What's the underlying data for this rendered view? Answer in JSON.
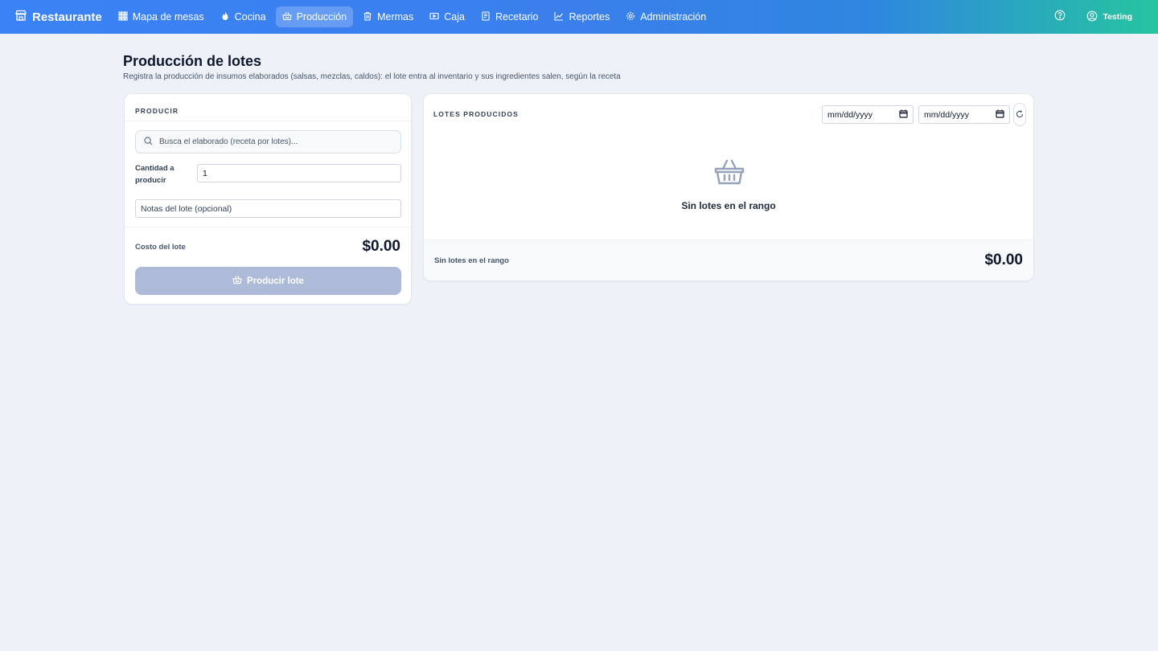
{
  "nav": {
    "brand": "Restaurante",
    "items": [
      {
        "label": "Mapa de mesas",
        "icon": "grid-icon",
        "active": false
      },
      {
        "label": "Cocina",
        "icon": "flame-icon",
        "active": false
      },
      {
        "label": "Producción",
        "icon": "basket-icon",
        "active": true
      },
      {
        "label": "Mermas",
        "icon": "trash-icon",
        "active": false
      },
      {
        "label": "Caja",
        "icon": "cash-icon",
        "active": false
      },
      {
        "label": "Recetario",
        "icon": "book-icon",
        "active": false
      },
      {
        "label": "Reportes",
        "icon": "chart-icon",
        "active": false
      },
      {
        "label": "Administración",
        "icon": "gear-icon",
        "active": false
      }
    ],
    "user": "Testing"
  },
  "page": {
    "title": "Producción de lotes",
    "subtitle": "Registra la producción de insumos elaborados (salsas, mezclas, caldos): el lote entra al inventario y sus ingredientes salen, según la receta"
  },
  "produce": {
    "section_label": "Producir",
    "search_placeholder": "Busca el elaborado (receta por lotes)...",
    "qty_label": "Cantidad a producir",
    "qty_value": "1",
    "notes_placeholder": "Notas del lote (opcional)",
    "cost_label": "Costo del lote",
    "cost_value": "$0.00",
    "button_label": "Producir lote"
  },
  "batches": {
    "section_label": "Lotes producidos",
    "date_from_placeholder": "mm/dd/yyyy",
    "date_to_placeholder": "mm/dd/yyyy",
    "empty_text": "Sin lotes en el rango",
    "footer_text": "Sin lotes en el rango",
    "footer_total": "$0.00"
  },
  "colors": {
    "accent": "#3b82f6",
    "accent_end": "#25c5a0",
    "disabled_button": "#aebbd8",
    "background": "#eef2f8"
  }
}
